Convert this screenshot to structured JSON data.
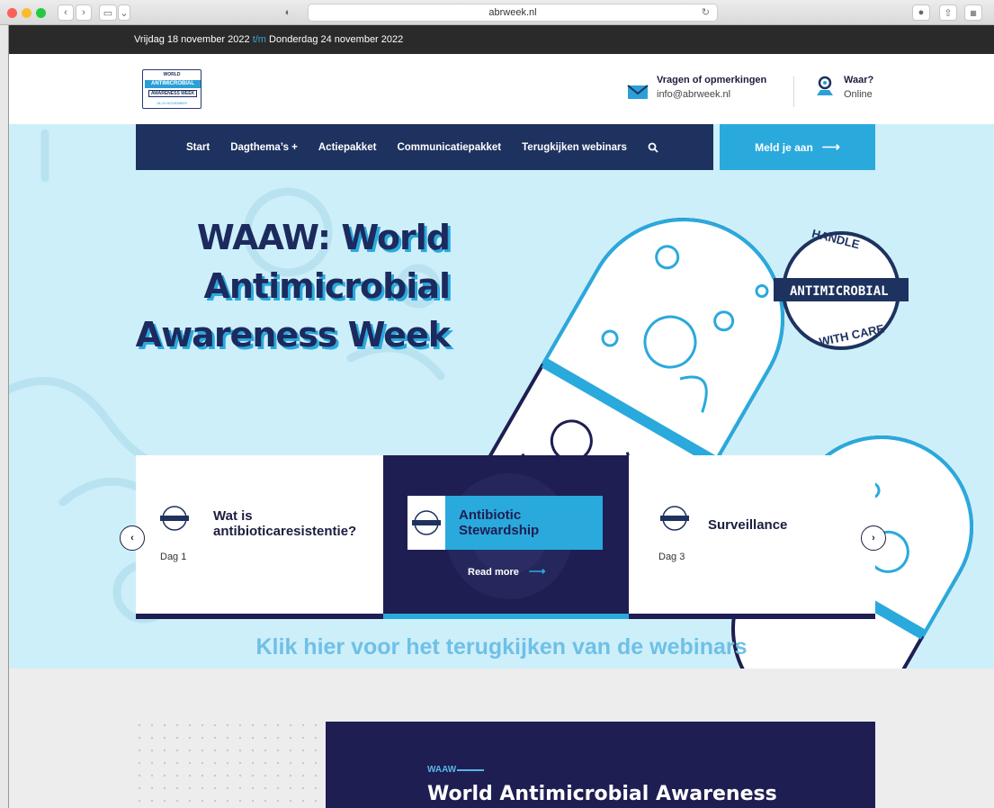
{
  "browser": {
    "url": "abrweek.nl"
  },
  "topbar": {
    "start": "Vrijdag 18 november 2022",
    "sep": "t/m",
    "end": "Donderdag 24 november 2022"
  },
  "logo": {
    "line1": "WORLD",
    "line2": "ANTIMICROBIAL",
    "line3": "AWARENESS WEEK",
    "line4": "18-24 NOVEMBER"
  },
  "contact": {
    "title": "Vragen of opmerkingen",
    "email": "info@abrweek.nl"
  },
  "location": {
    "title": "Waar?",
    "value": "Online"
  },
  "nav": {
    "items": [
      "Start",
      "Dagthema’s +",
      "Actiepakket",
      "Communicatiepakket",
      "Terugkijken webinars"
    ],
    "cta": "Meld je aan"
  },
  "hero": {
    "line1a": "WAAW: ",
    "line1b": "World",
    "line2": "Antimicrobial",
    "line3": "Awareness Week",
    "badge_top": "HANDLE",
    "badge_mid": "ANTIMICROBIAL",
    "badge_bot": "WITH CARE"
  },
  "cards": [
    {
      "title": "Wat is antibioticaresistentie?",
      "day": "Dag 1"
    },
    {
      "title": "Antibiotic Stewardship",
      "readmore": "Read more"
    },
    {
      "title": "Surveillance",
      "day": "Dag 3"
    }
  ],
  "webinar_link": "Klik hier voor het terugkijken van de webinars",
  "about": {
    "kicker": "WAAW",
    "heading": "World Antimicrobial Awareness"
  },
  "colors": {
    "navy": "#1e325f",
    "accent": "#2aa9dd",
    "hero_bg": "#cdeffa",
    "dark_card": "#1e1e52"
  }
}
